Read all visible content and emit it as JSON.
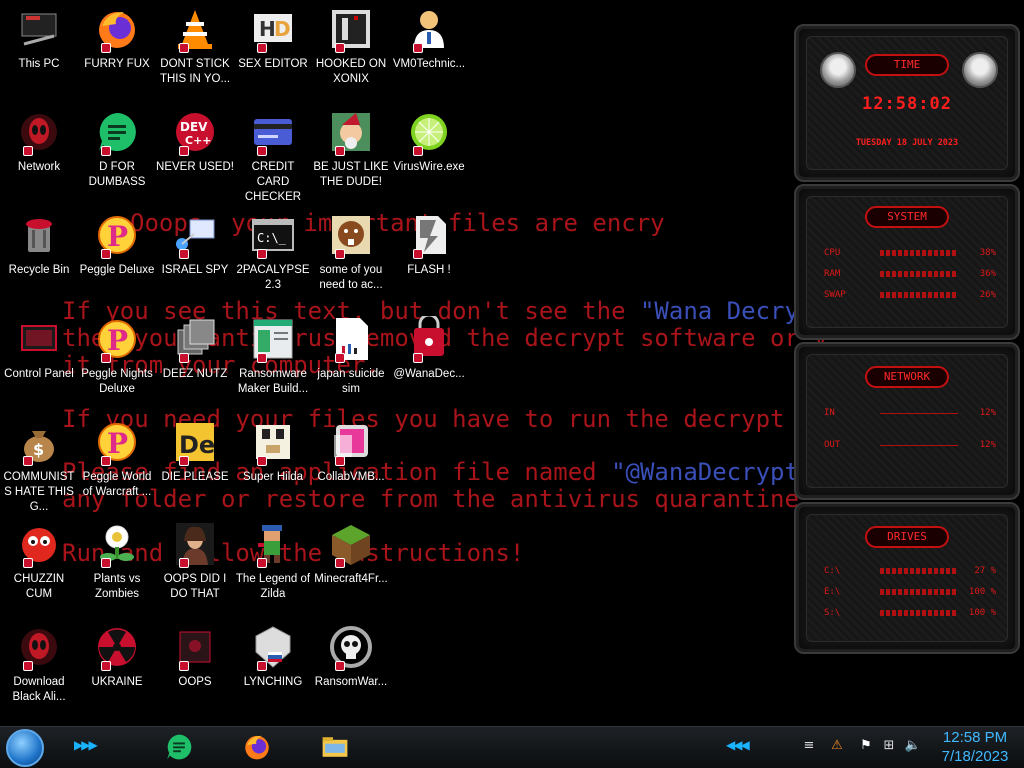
{
  "wallpaper": {
    "line1": "Ooops, your important files are encry",
    "line2a": "If you see this text, but don't see the ",
    "line2b": "\"Wana Decryp",
    "line3": "then your antivirus removed the decrypt software or y",
    "line4": "it from your computer.",
    "line5": "If you need your files you have to run the decrypt s",
    "line6a": "Please find an application file named ",
    "line6b": "\"@WanaDecrypto",
    "line7": "any folder or restore from the antivirus quarantine.",
    "line8": "Run and follow the instructions!"
  },
  "desktop_icons": [
    {
      "label": "This PC",
      "icon": "computer-icon"
    },
    {
      "label": "FURRY FUX",
      "icon": "firefox-icon"
    },
    {
      "label": "DONT STICK THIS IN YO...",
      "icon": "vlc-cone-icon"
    },
    {
      "label": "SEX EDITOR",
      "icon": "hxd-editor-icon"
    },
    {
      "label": "HOOKED ON XONIX",
      "icon": "xonix-game-icon"
    },
    {
      "label": "VM0Technic...",
      "icon": "doctor-avatar-icon"
    },
    {
      "label": "Network",
      "icon": "alien-network-icon"
    },
    {
      "label": "D FOR DUMBASS",
      "icon": "green-chat-icon"
    },
    {
      "label": "NEVER USED!",
      "icon": "devcpp-icon"
    },
    {
      "label": "CREDIT CARD CHECKER",
      "icon": "credit-card-icon"
    },
    {
      "label": "BE JUST LIKE THE DUDE!",
      "icon": "elf-avatar-icon"
    },
    {
      "label": "VirusWire.exe",
      "icon": "lime-icon"
    },
    {
      "label": "Recycle Bin",
      "icon": "recycle-bin-icon"
    },
    {
      "label": "Peggle Deluxe",
      "icon": "peggle-icon"
    },
    {
      "label": "ISRAEL SPY",
      "icon": "network-spy-icon"
    },
    {
      "label": "2PACALYPSE 2.3",
      "icon": "terminal-icon"
    },
    {
      "label": "some of you need to ac...",
      "icon": "beaver-icon"
    },
    {
      "label": "FLASH !",
      "icon": "flash-file-icon"
    },
    {
      "label": "Control Panel",
      "icon": "control-panel-icon"
    },
    {
      "label": "Peggle Nights Deluxe",
      "icon": "peggle-icon"
    },
    {
      "label": "DEEZ NUTZ",
      "icon": "stacked-windows-icon"
    },
    {
      "label": "Ransomware Maker Build...",
      "icon": "installer-icon"
    },
    {
      "label": "japan suicide sim",
      "icon": "blank-document-icon"
    },
    {
      "label": "@WanaDec...",
      "icon": "wanadecryptor-icon"
    },
    {
      "label": "COMMUNISTS HATE THIS G...",
      "icon": "money-bag-icon"
    },
    {
      "label": "Peggle World of Warcraft ...",
      "icon": "peggle-icon"
    },
    {
      "label": "DIE PLEASE",
      "icon": "de-icon"
    },
    {
      "label": "Super Hilda",
      "icon": "dog-pixel-icon"
    },
    {
      "label": "CollabVMB...",
      "icon": "collabvm-icon"
    },
    {
      "label": "CHUZZIN CUM",
      "icon": "chuzzle-icon"
    },
    {
      "label": "Plants vs Zombies",
      "icon": "plant-icon"
    },
    {
      "label": "OOPS DID I DO THAT",
      "icon": "portrait-icon"
    },
    {
      "label": "The Legend of Zilda",
      "icon": "pixel-hero-icon"
    },
    {
      "label": "Minecraft4Fr...",
      "icon": "grass-block-icon"
    },
    {
      "label": "Download Black Ali...",
      "icon": "alien-download-icon"
    },
    {
      "label": "UKRAINE",
      "icon": "radiation-icon"
    },
    {
      "label": "OOPS",
      "icon": "dark-box-icon"
    },
    {
      "label": "LYNCHING",
      "icon": "shield-badge-icon"
    },
    {
      "label": "RansomWar...",
      "icon": "skull-icon"
    }
  ],
  "widgets": {
    "time": {
      "title": "TIME",
      "clock": "12:58:02",
      "date": "TUESDAY 18 JULY 2023"
    },
    "system": {
      "title": "SYSTEM",
      "rows": [
        {
          "name": "CPU",
          "value": "38%",
          "level": 0.38
        },
        {
          "name": "RAM",
          "value": "36%",
          "level": 0.36
        },
        {
          "name": "SWAP",
          "value": "26%",
          "level": 0.26
        }
      ]
    },
    "network": {
      "title": "NETWORK",
      "rows": [
        {
          "name": "IN",
          "value": "12%"
        },
        {
          "name": "OUT",
          "value": "12%"
        }
      ]
    },
    "drives": {
      "title": "DRIVES",
      "rows": [
        {
          "name": "C:\\",
          "value": "27 %"
        },
        {
          "name": "E:\\",
          "value": "100 %"
        },
        {
          "name": "S:\\",
          "value": "100 %"
        }
      ]
    }
  },
  "taskbar": {
    "apps": [
      {
        "icon": "green-chat-icon"
      },
      {
        "icon": "firefox-icon"
      },
      {
        "icon": "file-explorer-icon"
      }
    ],
    "tray": [
      "shield-warning-icon",
      "flag-icon",
      "network-icon",
      "volume-icon"
    ],
    "time": "12:58 PM",
    "date": "7/18/2023"
  },
  "colors": {
    "ransom_text": "#a8141a",
    "widget_red": "#e01818",
    "clock_blue": "#3fb8ff"
  }
}
